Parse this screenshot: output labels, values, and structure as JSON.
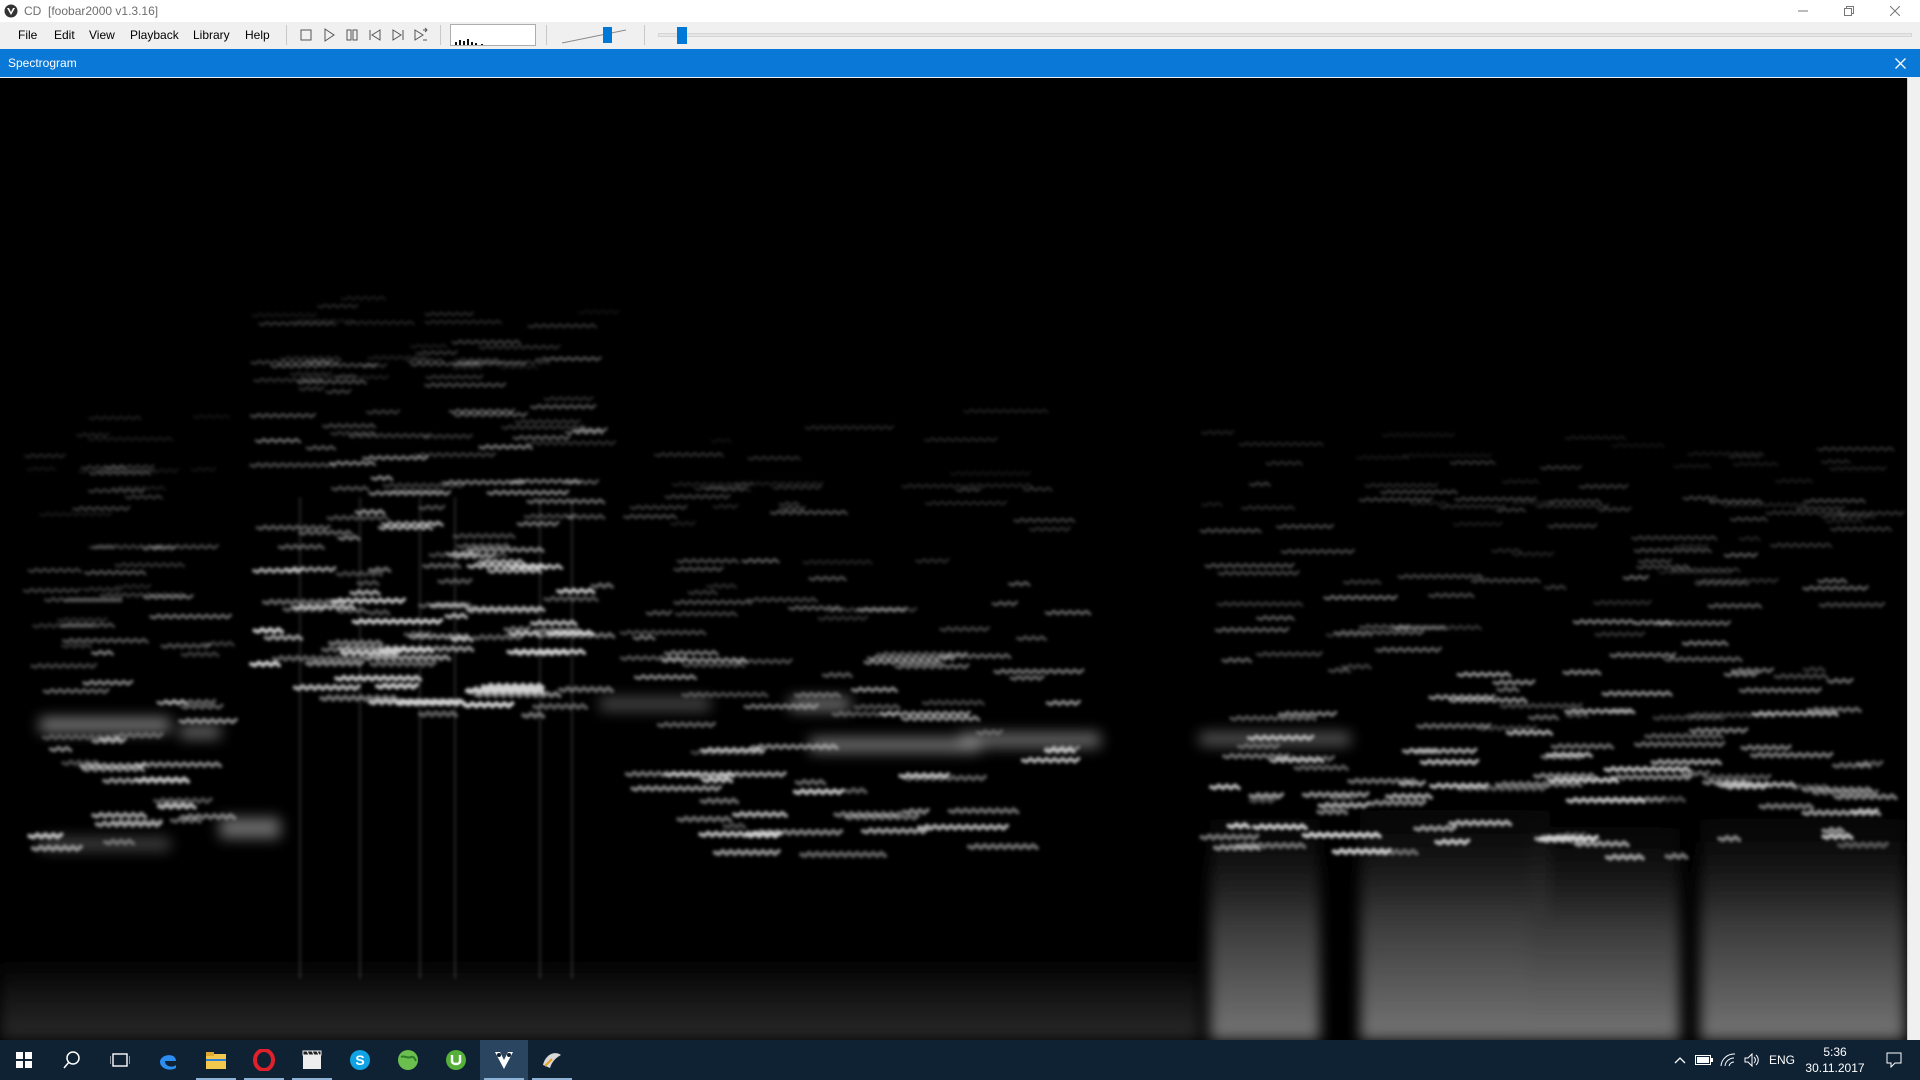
{
  "window": {
    "title": "CD  [foobar2000 v1.3.16]"
  },
  "menu": [
    "File",
    "Edit",
    "View",
    "Playback",
    "Library",
    "Help"
  ],
  "toolbar": {
    "buttons": [
      "stop-icon",
      "play-icon",
      "pause-icon",
      "previous-icon",
      "next-icon",
      "random-icon"
    ],
    "volume_level": 0.75,
    "seek_position": 0.015
  },
  "panel": {
    "title": "Spectrogram",
    "close_icon": "close-icon"
  },
  "colors": {
    "accent": "#0a78d7",
    "spectrogram_bg": "#000000",
    "taskbar": "#0f2234"
  },
  "taskbar": {
    "apps": [
      "start-icon",
      "search-icon",
      "task-view-icon",
      "edge-icon",
      "file-explorer-icon",
      "opera-icon",
      "media-player-classic-icon",
      "skype-icon",
      "globe-app-icon",
      "utorrent-icon",
      "foobar2000-icon",
      "winamp-icon"
    ],
    "active_app": "foobar2000-icon",
    "language": "ENG",
    "time": "5:36",
    "date": "30.11.2017"
  }
}
